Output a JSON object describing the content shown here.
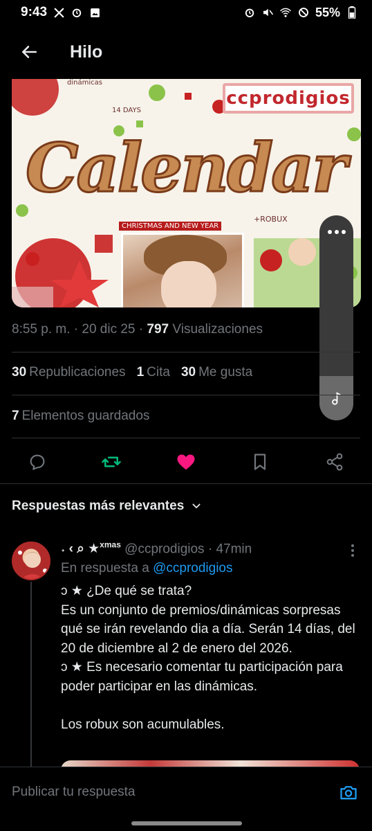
{
  "status_bar": {
    "time": "9:43",
    "battery": "55%",
    "icons": [
      "x-logo-icon",
      "alarm-icon",
      "image-icon",
      "alarm-icon",
      "mute-icon",
      "wifi-icon",
      "do-not-disturb-icon",
      "battery-icon"
    ]
  },
  "header": {
    "title": "Hilo",
    "back_icon": "arrow-left-icon"
  },
  "banner": {
    "brand": "ccprodigios",
    "top_small": "dinámicas",
    "days": "14 DAYS",
    "title": "Calendar",
    "subtitle": "CHRISTMAS AND NEW YEAR",
    "robux": "+ROBUX"
  },
  "post_meta": {
    "time": "8:55 p. m.",
    "date": "20 dic 25",
    "views_count": "797",
    "views_label": "Visualizaciones"
  },
  "stats": [
    {
      "count": "30",
      "label": "Republicaciones"
    },
    {
      "count": "1",
      "label": "Cita"
    },
    {
      "count": "30",
      "label": "Me gusta"
    }
  ],
  "saved": {
    "count": "7",
    "label": "Elementos guardados"
  },
  "actions": {
    "reply_icon": "comment-icon",
    "repost_icon": "repost-icon",
    "like_icon": "heart-icon",
    "bookmark_icon": "bookmark-icon",
    "share_icon": "share-icon",
    "repost_color": "#00ba7c",
    "like_color": "#f91880"
  },
  "relevant": {
    "label": "Respuestas más relevantes"
  },
  "reply": {
    "name": "˖ ‹ ⌕ ★",
    "name_sup": "xmas",
    "handle": "@ccprodigios",
    "time": "47min",
    "reply_to_label": "En respuesta a",
    "reply_to_handle": "@ccprodigios",
    "lines": [
      "ɔ ★  ¿De qué se trata?",
      "Es un conjunto de premios/dinámicas sorpresas qué se irán revelando dia a día. Serán 14 días, del 20 de diciembre al 2 de enero del 2026.",
      "ɔ ★ Es necesario comentar tu participación para poder participar en las dinámicas.",
      "",
      "Los robux son acumulables."
    ]
  },
  "composer": {
    "placeholder": "Publicar tu respuesta",
    "camera_icon": "camera-icon",
    "accent": "#1d9bf0"
  }
}
